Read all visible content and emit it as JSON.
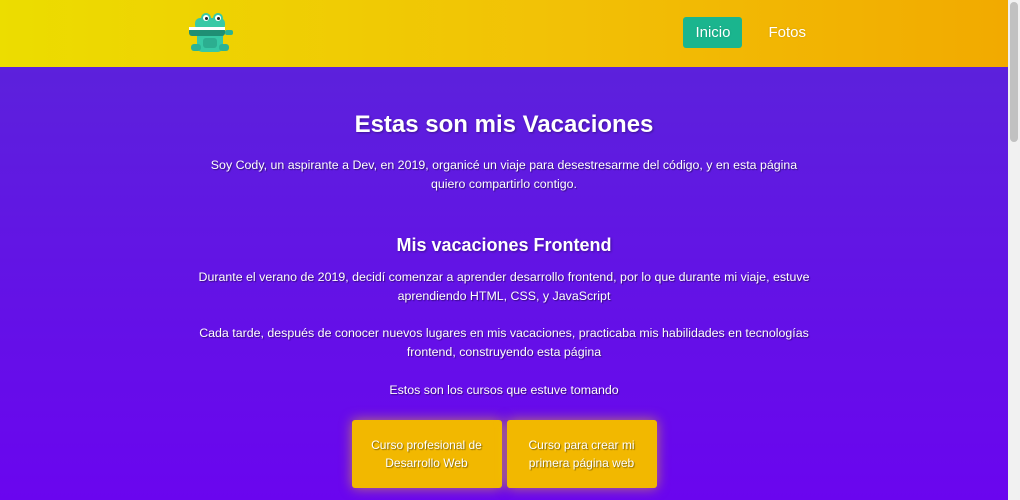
{
  "header": {
    "logo_icon": "crocodile-mascot-icon",
    "nav": [
      {
        "label": "Inicio",
        "active": true
      },
      {
        "label": "Fotos",
        "active": false
      }
    ]
  },
  "main": {
    "title": "Estas son mis Vacaciones",
    "intro": "Soy Cody, un aspirante a Dev, en 2019, organicé un viaje para desestresarme del código, y en esta página quiero compartirlo contigo.",
    "section_title": "Mis vacaciones Frontend",
    "paragraph_1": "Durante el verano de 2019, decidí comenzar a aprender desarrollo frontend, por lo que durante mi viaje, estuve aprendiendo HTML, CSS, y JavaScript",
    "paragraph_2": "Cada tarde, después de conocer nuevos lugares en mis vacaciones, practicaba mis habilidades en tecnologías frontend, construyendo esta página",
    "courses_intro": "Estos son los cursos que estuve tomando",
    "courses": [
      {
        "label": "Curso profesional de Desarrollo Web"
      },
      {
        "label": "Curso para crear mi primera página web"
      }
    ]
  },
  "colors": {
    "header_gradient_start": "#ecdd00",
    "header_gradient_end": "#f2aa00",
    "nav_active": "#1ab58e",
    "main_background": "#6a05ef",
    "course_card": "#f2b800"
  }
}
